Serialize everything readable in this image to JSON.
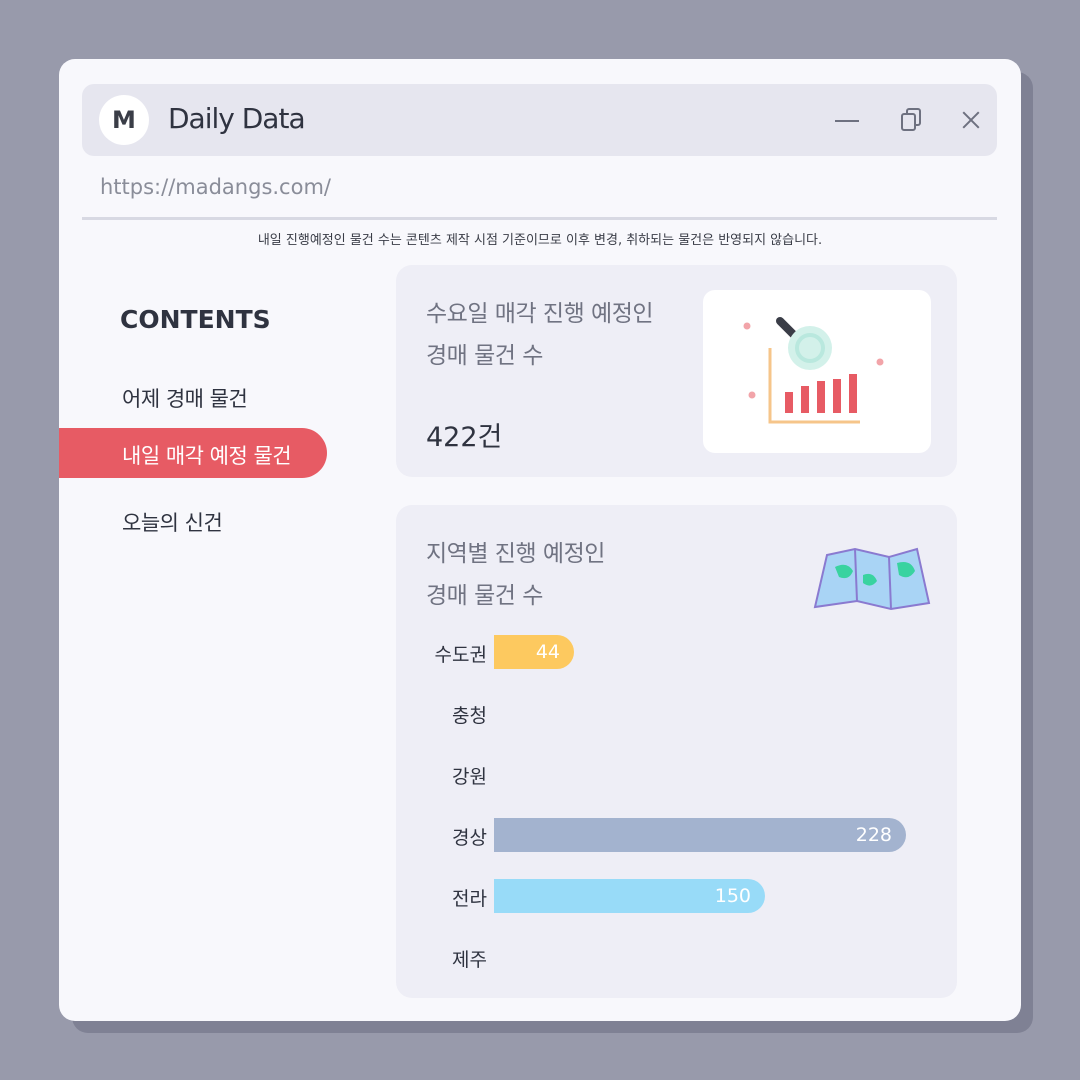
{
  "app": {
    "logo_letter": "M",
    "title": "Daily Data",
    "url": "https://madangs.com/"
  },
  "notice": "내일 진행예정인 물건 수는 콘텐츠 제작 시점 기준이므로 이후 변경, 취하되는 물건은 반영되지 않습니다.",
  "sidebar": {
    "heading": "CONTENTS",
    "items": [
      {
        "label": "어제 경매 물건",
        "active": false
      },
      {
        "label": "내일 매각 예정 물건",
        "active": true
      },
      {
        "label": "오늘의 신건",
        "active": false
      }
    ]
  },
  "card1": {
    "title": "수요일 매각 진행 예정인\n경매 물건 수",
    "value": "422건",
    "illustration": "chart-magnifier-icon"
  },
  "card2": {
    "title": "지역별 진행 예정인\n경매 물건 수",
    "illustration": "map-icon"
  },
  "colors": {
    "accent": "#e75b64",
    "bar_capital": "#fdc95f",
    "bar_gyeongsang": "#a3b3cf",
    "bar_jeolla": "#98dbf8"
  },
  "chart_data": {
    "type": "bar",
    "orientation": "horizontal",
    "categories": [
      "수도권",
      "충청",
      "강원",
      "경상",
      "전라",
      "제주"
    ],
    "values": [
      44,
      null,
      null,
      228,
      150,
      null
    ],
    "value_labels": [
      "44",
      "",
      "",
      "228",
      "150",
      ""
    ],
    "bar_colors": [
      "#fdc95f",
      null,
      null,
      "#a3b3cf",
      "#98dbf8",
      null
    ],
    "xlim": [
      0,
      228
    ]
  }
}
